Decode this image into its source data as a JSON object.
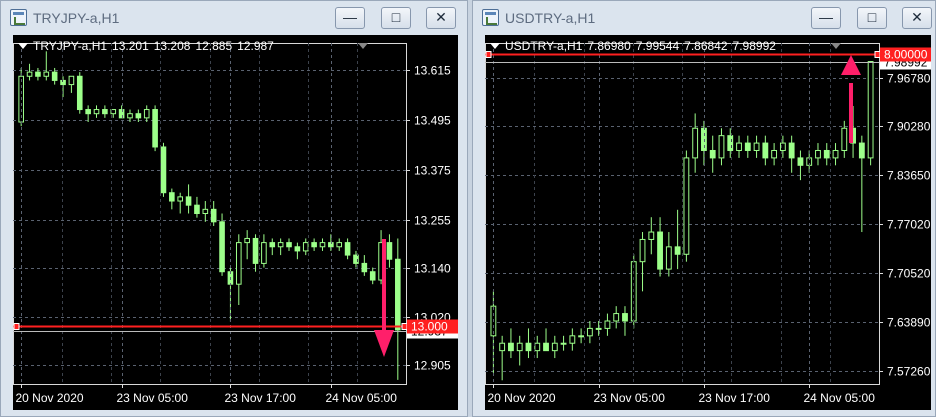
{
  "windows": [
    {
      "id": "trjpy",
      "title": "TRYJPY-a,H1",
      "header": {
        "symbol": "TRYJPY-a,H1",
        "ohlc": [
          "13.201",
          "13.208",
          "12.885",
          "12.987"
        ]
      },
      "price_labels": [
        "13.615",
        "13.495",
        "13.375",
        "13.255",
        "13.140",
        "13.020",
        "12.905"
      ],
      "time_labels": [
        "20 Nov 2020",
        "23 Nov 05:00",
        "23 Nov 17:00",
        "24 Nov 05:00"
      ],
      "level_label": "13.000",
      "current_label": "12.987",
      "arrow": "down",
      "colors": {
        "bull": "#9dff8a",
        "bear": "#9dff8a",
        "level": "#ff2020",
        "arrow": "#ff1f6a"
      }
    },
    {
      "id": "usdtry",
      "title": "USDTRY-a,H1",
      "header": {
        "symbol": "USDTRY-a,H1",
        "ohlc": [
          "7.86980",
          "7.99544",
          "7.86842",
          "7.98992"
        ]
      },
      "price_labels": [
        "7.96780",
        "7.90280",
        "7.83650",
        "7.77020",
        "7.70520",
        "7.63890",
        "7.57260"
      ],
      "time_labels": [
        "20 Nov 2020",
        "23 Nov 05:00",
        "23 Nov 17:00",
        "24 Nov 05:00"
      ],
      "level_label": "8.00000",
      "current_label": "7.98992",
      "arrow": "up",
      "colors": {
        "bull": "#9dff8a",
        "bear": "#9dff8a",
        "level": "#ff2020",
        "arrow": "#ff1f6a"
      }
    }
  ],
  "chart_data": [
    {
      "type": "candlestick",
      "title": "TRYJPY-a,H1",
      "ylim": [
        12.86,
        13.68
      ],
      "y_ticks": [
        13.615,
        13.495,
        13.375,
        13.255,
        13.14,
        13.02,
        12.905
      ],
      "x_ticks": [
        "20 Nov 2020",
        "23 Nov 05:00",
        "23 Nov 17:00",
        "24 Nov 05:00"
      ],
      "level": 13.0,
      "ohlc": [
        [
          13.49,
          13.62,
          13.48,
          13.6
        ],
        [
          13.6,
          13.63,
          13.59,
          13.61
        ],
        [
          13.61,
          13.62,
          13.59,
          13.6
        ],
        [
          13.6,
          13.66,
          13.59,
          13.61
        ],
        [
          13.61,
          13.62,
          13.58,
          13.59
        ],
        [
          13.59,
          13.6,
          13.55,
          13.58
        ],
        [
          13.58,
          13.6,
          13.56,
          13.6
        ],
        [
          13.6,
          13.61,
          13.51,
          13.52
        ],
        [
          13.52,
          13.53,
          13.49,
          13.51
        ],
        [
          13.51,
          13.53,
          13.5,
          13.52
        ],
        [
          13.52,
          13.53,
          13.5,
          13.51
        ],
        [
          13.51,
          13.52,
          13.5,
          13.52
        ],
        [
          13.52,
          13.53,
          13.5,
          13.5
        ],
        [
          13.5,
          13.52,
          13.49,
          13.51
        ],
        [
          13.51,
          13.52,
          13.49,
          13.5
        ],
        [
          13.5,
          13.53,
          13.49,
          13.52
        ],
        [
          13.52,
          13.53,
          13.42,
          13.43
        ],
        [
          13.43,
          13.44,
          13.31,
          13.32
        ],
        [
          13.32,
          13.33,
          13.28,
          13.3
        ],
        [
          13.3,
          13.32,
          13.27,
          13.31
        ],
        [
          13.31,
          13.34,
          13.27,
          13.29
        ],
        [
          13.29,
          13.31,
          13.26,
          13.27
        ],
        [
          13.27,
          13.3,
          13.25,
          13.28
        ],
        [
          13.28,
          13.3,
          13.24,
          13.25
        ],
        [
          13.25,
          13.27,
          13.12,
          13.13
        ],
        [
          13.13,
          13.14,
          13.01,
          13.1
        ],
        [
          13.1,
          13.22,
          13.05,
          13.2
        ],
        [
          13.2,
          13.23,
          13.16,
          13.21
        ],
        [
          13.21,
          13.22,
          13.13,
          13.15
        ],
        [
          13.15,
          13.22,
          13.14,
          13.2
        ],
        [
          13.2,
          13.21,
          13.17,
          13.19
        ],
        [
          13.19,
          13.21,
          13.17,
          13.2
        ],
        [
          13.2,
          13.21,
          13.18,
          13.19
        ],
        [
          13.19,
          13.2,
          13.16,
          13.18
        ],
        [
          13.18,
          13.21,
          13.17,
          13.2
        ],
        [
          13.2,
          13.21,
          13.18,
          13.19
        ],
        [
          13.19,
          13.21,
          13.18,
          13.2
        ],
        [
          13.2,
          13.22,
          13.18,
          13.19
        ],
        [
          13.19,
          13.21,
          13.18,
          13.2
        ],
        [
          13.2,
          13.21,
          13.16,
          13.17
        ],
        [
          13.17,
          13.18,
          13.14,
          13.15
        ],
        [
          13.15,
          13.17,
          13.12,
          13.13
        ],
        [
          13.13,
          13.14,
          13.1,
          13.11
        ],
        [
          13.11,
          13.23,
          13.1,
          13.2
        ],
        [
          13.2,
          13.22,
          13.14,
          13.16
        ],
        [
          13.16,
          13.21,
          12.87,
          12.99
        ]
      ]
    },
    {
      "type": "candlestick",
      "title": "USDTRY-a,H1",
      "ylim": [
        7.555,
        8.015
      ],
      "y_ticks": [
        7.9678,
        7.9028,
        7.8365,
        7.7702,
        7.7052,
        7.6389,
        7.5726
      ],
      "x_ticks": [
        "20 Nov 2020",
        "23 Nov 05:00",
        "23 Nov 17:00",
        "24 Nov 05:00"
      ],
      "level": 8.0,
      "ohlc": [
        [
          7.62,
          7.68,
          7.57,
          7.66
        ],
        [
          7.6,
          7.62,
          7.56,
          7.61
        ],
        [
          7.61,
          7.63,
          7.59,
          7.6
        ],
        [
          7.6,
          7.62,
          7.58,
          7.61
        ],
        [
          7.61,
          7.63,
          7.59,
          7.6
        ],
        [
          7.6,
          7.62,
          7.59,
          7.61
        ],
        [
          7.61,
          7.63,
          7.6,
          7.6
        ],
        [
          7.6,
          7.62,
          7.59,
          7.61
        ],
        [
          7.61,
          7.62,
          7.6,
          7.61
        ],
        [
          7.61,
          7.63,
          7.6,
          7.62
        ],
        [
          7.62,
          7.63,
          7.61,
          7.62
        ],
        [
          7.62,
          7.64,
          7.61,
          7.63
        ],
        [
          7.63,
          7.64,
          7.62,
          7.63
        ],
        [
          7.63,
          7.65,
          7.62,
          7.64
        ],
        [
          7.64,
          7.66,
          7.63,
          7.65
        ],
        [
          7.65,
          7.66,
          7.62,
          7.64
        ],
        [
          7.64,
          7.73,
          7.63,
          7.72
        ],
        [
          7.72,
          7.76,
          7.68,
          7.75
        ],
        [
          7.75,
          7.78,
          7.73,
          7.76
        ],
        [
          7.76,
          7.78,
          7.7,
          7.71
        ],
        [
          7.71,
          7.76,
          7.7,
          7.74
        ],
        [
          7.74,
          7.79,
          7.71,
          7.73
        ],
        [
          7.73,
          7.87,
          7.72,
          7.86
        ],
        [
          7.86,
          7.92,
          7.84,
          7.9
        ],
        [
          7.9,
          7.91,
          7.85,
          7.87
        ],
        [
          7.87,
          7.89,
          7.84,
          7.86
        ],
        [
          7.86,
          7.9,
          7.85,
          7.89
        ],
        [
          7.89,
          7.9,
          7.86,
          7.87
        ],
        [
          7.87,
          7.89,
          7.86,
          7.88
        ],
        [
          7.88,
          7.89,
          7.86,
          7.87
        ],
        [
          7.87,
          7.89,
          7.86,
          7.88
        ],
        [
          7.88,
          7.89,
          7.85,
          7.86
        ],
        [
          7.86,
          7.88,
          7.85,
          7.87
        ],
        [
          7.87,
          7.89,
          7.86,
          7.88
        ],
        [
          7.88,
          7.89,
          7.84,
          7.86
        ],
        [
          7.86,
          7.87,
          7.83,
          7.85
        ],
        [
          7.85,
          7.87,
          7.84,
          7.86
        ],
        [
          7.86,
          7.88,
          7.85,
          7.87
        ],
        [
          7.87,
          7.88,
          7.85,
          7.86
        ],
        [
          7.86,
          7.88,
          7.85,
          7.87
        ],
        [
          7.87,
          7.91,
          7.86,
          7.9
        ],
        [
          7.9,
          7.93,
          7.86,
          7.88
        ],
        [
          7.88,
          7.89,
          7.76,
          7.86
        ],
        [
          7.86,
          7.99,
          7.85,
          7.99
        ]
      ]
    }
  ]
}
